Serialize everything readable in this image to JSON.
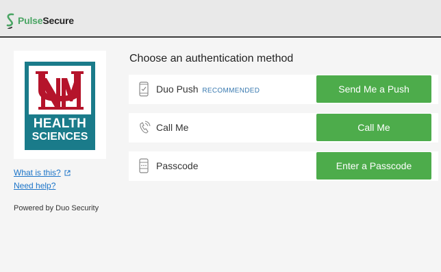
{
  "header": {
    "brand_pulse": "Pulse",
    "brand_secure": "Secure"
  },
  "org": {
    "logo_line1": "HEALTH",
    "logo_line2": "SCIENCES"
  },
  "sidebar": {
    "what_is_this": "What is this?",
    "need_help": "Need help?",
    "powered_by": "Powered by Duo Security"
  },
  "main": {
    "title": "Choose an authentication method",
    "methods": [
      {
        "label": "Duo Push",
        "badge": "RECOMMENDED",
        "button": "Send Me a Push",
        "icon": "phone-check-icon"
      },
      {
        "label": "Call Me",
        "badge": "",
        "button": "Call Me",
        "icon": "phone-call-icon"
      },
      {
        "label": "Passcode",
        "badge": "",
        "button": "Enter a Passcode",
        "icon": "passcode-device-icon"
      }
    ]
  },
  "colors": {
    "brand_green": "#4aa564",
    "button_green": "#4dac4b",
    "link_blue": "#1a73c8",
    "logo_teal": "#1a7b8a",
    "logo_red": "#b5142b"
  }
}
